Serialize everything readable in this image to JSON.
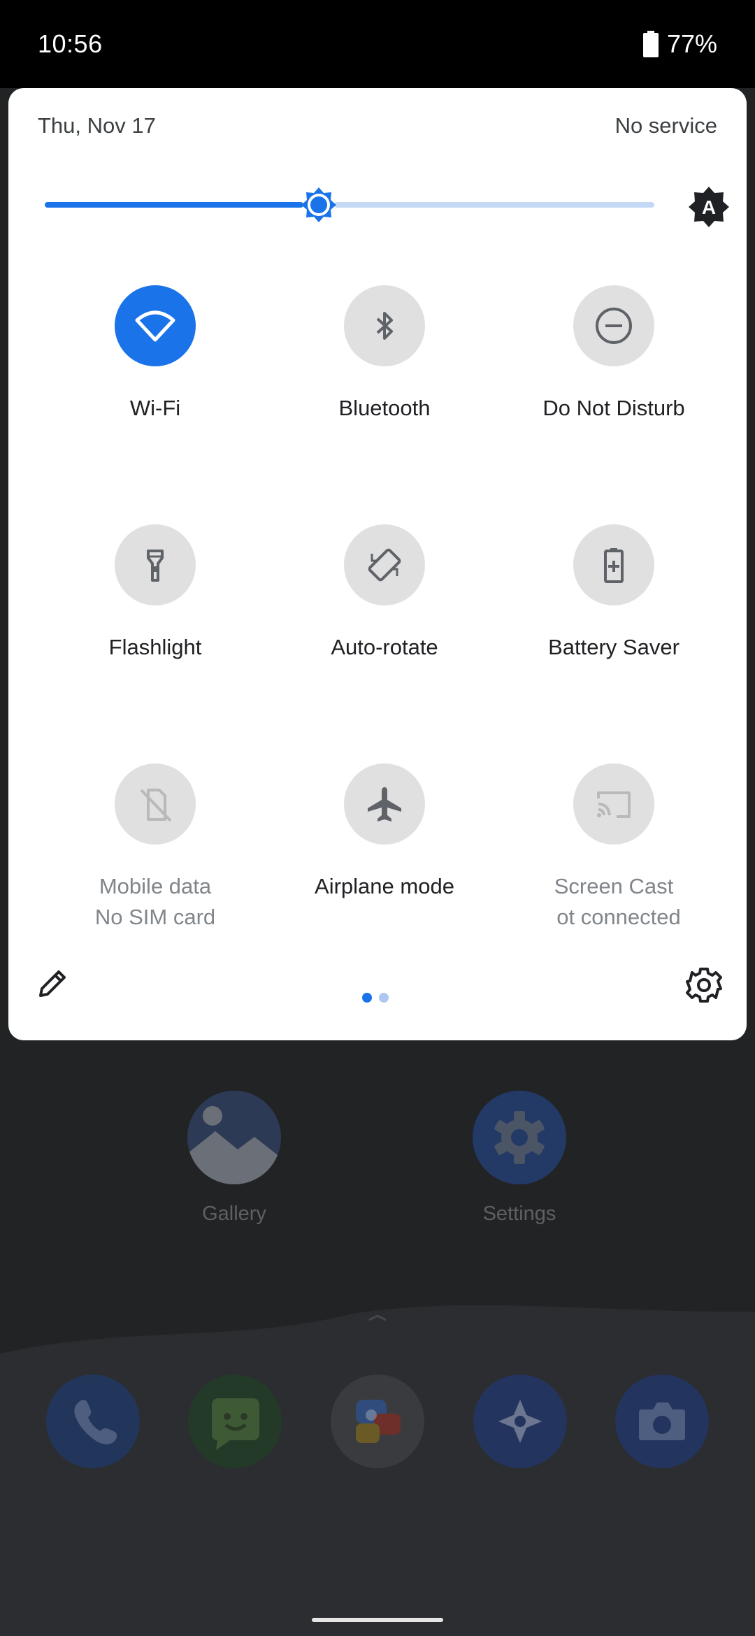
{
  "status_bar": {
    "time": "10:56",
    "battery_percent": "77%",
    "battery_level": 0.77
  },
  "quick_settings": {
    "date": "Thu, Nov 17",
    "carrier": "No service",
    "brightness_level": 0.45,
    "tiles": [
      {
        "label": "Wi-Fi",
        "sub": "",
        "active": true,
        "icon": "wifi-icon"
      },
      {
        "label": "Bluetooth",
        "sub": "",
        "active": false,
        "icon": "bluetooth-icon"
      },
      {
        "label": "Do Not Disturb",
        "sub": "",
        "active": false,
        "icon": "do-not-disturb-icon"
      },
      {
        "label": "Flashlight",
        "sub": "",
        "active": false,
        "icon": "flashlight-icon"
      },
      {
        "label": "Auto-rotate",
        "sub": "",
        "active": false,
        "icon": "auto-rotate-icon"
      },
      {
        "label": "Battery Saver",
        "sub": "",
        "active": false,
        "icon": "battery-saver-icon"
      },
      {
        "label": "Mobile data",
        "sub": "No SIM card",
        "active": false,
        "disabled": true,
        "icon": "mobile-data-off-icon"
      },
      {
        "label": "Airplane mode",
        "sub": "",
        "active": false,
        "icon": "airplane-icon"
      },
      {
        "label": "Screen Cast",
        "sub": "ot connected",
        "active": false,
        "disabled": true,
        "icon": "cast-icon"
      }
    ],
    "page_count": 2,
    "current_page": 1,
    "accent_color": "#1a73e8"
  },
  "home": {
    "apps": [
      {
        "label": "Gallery",
        "icon": "gallery-icon"
      },
      {
        "label": "Settings",
        "icon": "settings-app-icon"
      }
    ],
    "dock": [
      "phone-icon",
      "messages-icon",
      "assistant-icon",
      "maps-icon",
      "camera-icon"
    ]
  }
}
